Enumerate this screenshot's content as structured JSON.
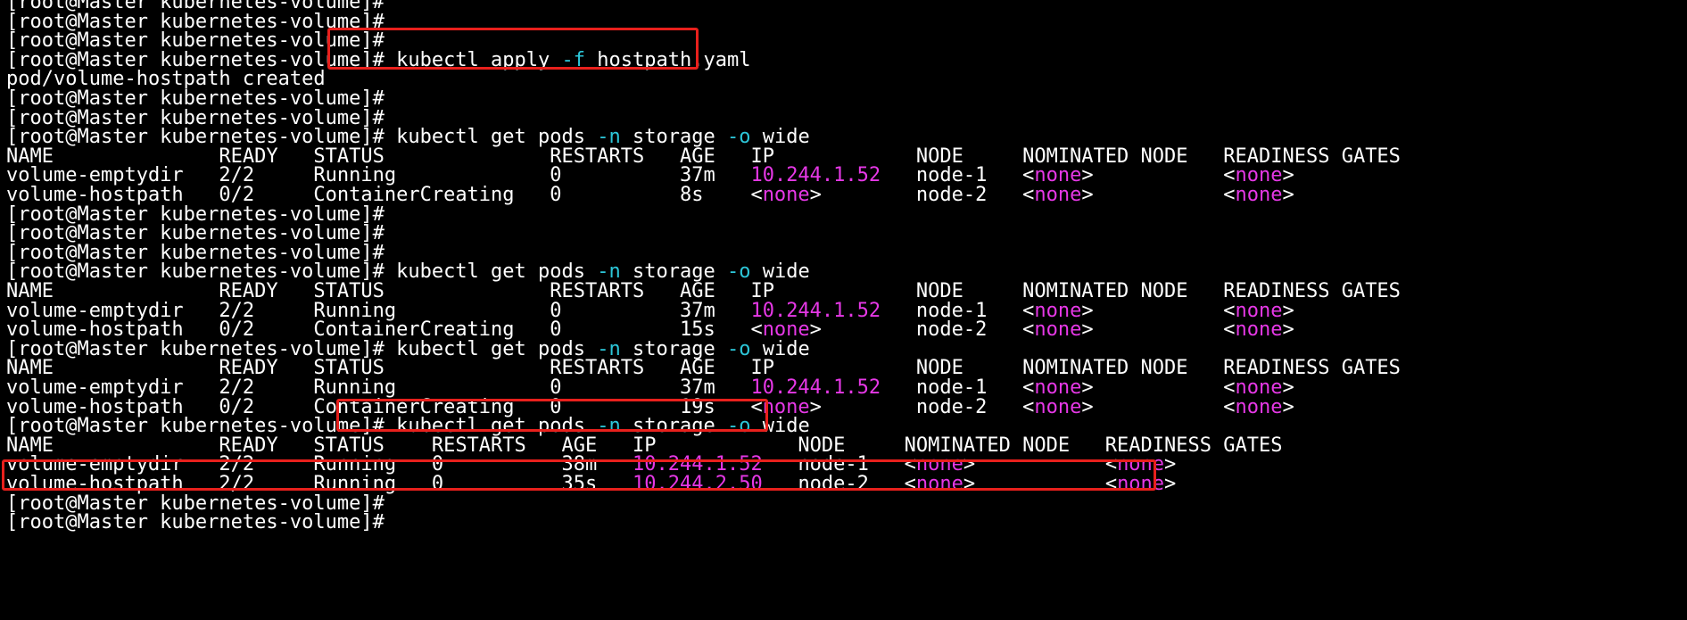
{
  "terminal": {
    "prompt": "[root@Master kubernetes-volume]#",
    "apply_cmd": " kubectl apply -f hostpath.yaml",
    "apply_output": "pod/volume-hostpath created",
    "get_cmd": " kubectl get pods -n storage -o wide",
    "header_1": "NAME              READY   STATUS              RESTARTS   AGE   IP            NODE     NOMINATED NODE   READINESS GATES",
    "header_2": "NAME              READY   STATUS    RESTARTS   AGE   IP            NODE     NOMINATED NODE   READINESS GATES",
    "rows": [
      "volume-emptydir   2/2     Running             0          37m   10.244.1.52   node-1   <none>           <none>",
      "volume-hostpath   0/2     ContainerCreating   0          8s    <none>        node-2   <none>           <none>",
      "volume-emptydir   2/2     Running             0          37m   10.244.1.52   node-1   <none>           <none>",
      "volume-hostpath   0/2     ContainerCreating   0          15s   <none>        node-2   <none>           <none>",
      "volume-emptydir   2/2     Running             0          37m   10.244.1.52   node-1   <none>           <none>",
      "volume-hostpath   0/2     ContainerCreating   0          19s   <none>        node-2   <none>           <none>",
      "volume-emptydir   2/2     Running   0          38m   10.244.1.52   node-1   <none>           <none>",
      "volume-hostpath   2/2     Running   0          35s   10.244.2.50   node-2   <none>           <none>"
    ]
  },
  "colors": {
    "background": "#000000",
    "text": "#ffffff",
    "flag": "#2cc6d8",
    "highlight_value": "#e638e6",
    "annotation_box": "#e8201c"
  }
}
